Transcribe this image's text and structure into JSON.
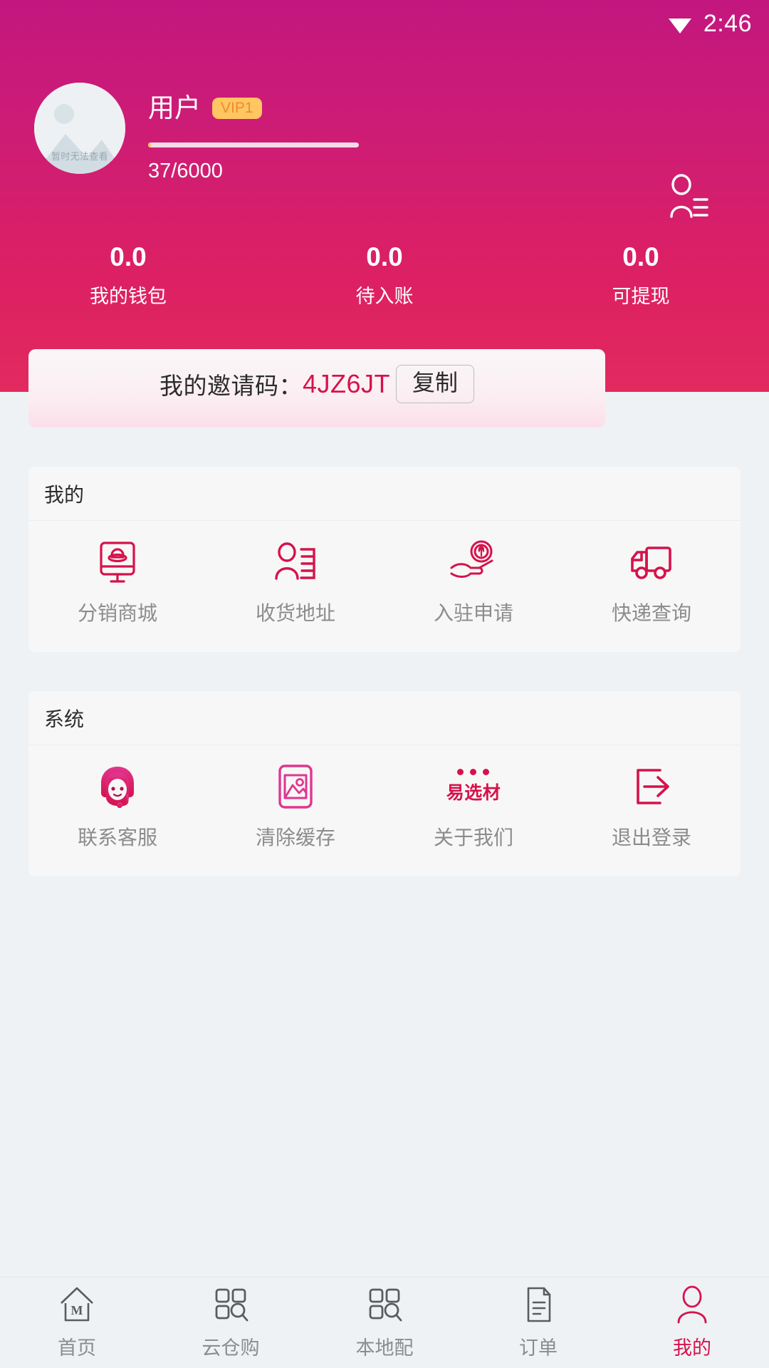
{
  "statusbar": {
    "time": "2:46",
    "wifi_icon": "wifi-icon"
  },
  "header": {
    "avatar": {
      "placeholder_text": "暂时无法查看",
      "icon": "image-placeholder-icon"
    },
    "username": "用户",
    "vip_badge": "VIP1",
    "experience": "37/6000",
    "experience_current": 37,
    "experience_max": 6000,
    "contacts_icon": "user-list-icon",
    "accent_color": "#d6124b",
    "gradient_start": "#c3177f",
    "gradient_end": "#e22a5f",
    "vip_color": "#ffc662",
    "stats": [
      {
        "value": "0.0",
        "label": "我的钱包"
      },
      {
        "value": "0.0",
        "label": "待入账"
      },
      {
        "value": "0.0",
        "label": "可提现"
      }
    ]
  },
  "invite": {
    "label": "我的邀请码：",
    "code": "4JZ6JT",
    "copy_label": "复制",
    "code_color": "#d6124b"
  },
  "sections": [
    {
      "title": "我的",
      "items": [
        {
          "label": "分销商城",
          "icon": "monitor-shop-icon"
        },
        {
          "label": "收货地址",
          "icon": "address-person-list-icon"
        },
        {
          "label": "入驻申请",
          "icon": "hand-coin-icon"
        },
        {
          "label": "快递查询",
          "icon": "truck-icon"
        }
      ]
    },
    {
      "title": "系统",
      "items": [
        {
          "label": "联系客服",
          "icon": "headset-agent-icon"
        },
        {
          "label": "清除缓存",
          "icon": "image-photo-icon"
        },
        {
          "label": "关于我们",
          "icon": "brand-logo-icon",
          "logo_word": "易选材"
        },
        {
          "label": "退出登录",
          "icon": "logout-arrow-icon"
        }
      ]
    }
  ],
  "bottomnav": {
    "active_index": 4,
    "items": [
      {
        "label": "首页",
        "icon": "home-icon"
      },
      {
        "label": "云仓购",
        "icon": "cloud-warehouse-search-icon"
      },
      {
        "label": "本地配",
        "icon": "local-delivery-search-icon"
      },
      {
        "label": "订单",
        "icon": "order-document-icon"
      },
      {
        "label": "我的",
        "icon": "profile-person-icon"
      }
    ]
  }
}
